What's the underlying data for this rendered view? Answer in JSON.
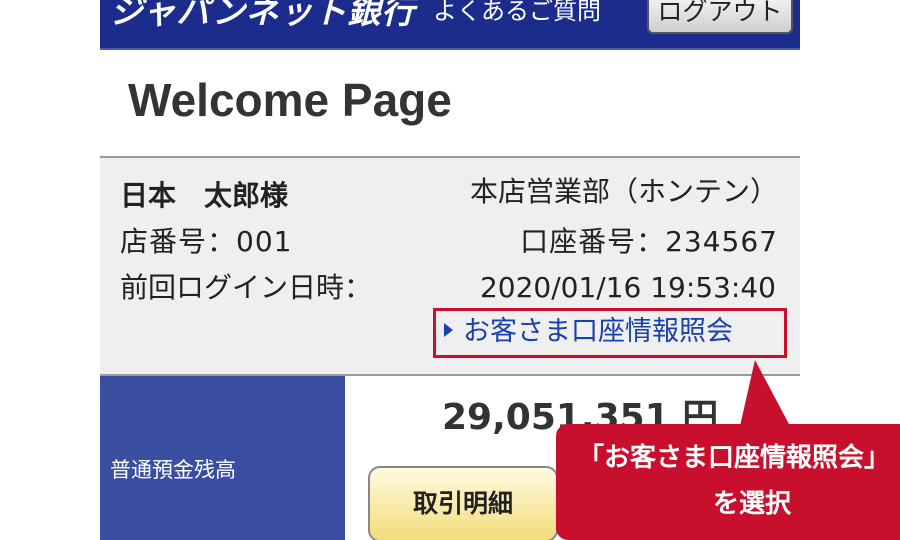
{
  "header": {
    "logo": "ジャパンネット銀行",
    "faq": "よくあるご質問",
    "logout": "ログアウト"
  },
  "page_title": "Welcome Page",
  "account_info": {
    "customer_name": "日本　太郎様",
    "branch_name": "本店営業部（ホンテン）",
    "store_number": "店番号：001",
    "account_number": "口座番号：234567",
    "last_login_label": "前回ログイン日時：",
    "last_login_value": "2020/01/16 19:53:40",
    "account_info_link": "お客さま口座情報照会"
  },
  "balance": {
    "label": "普通預金残高",
    "amount": "29,051,351 円",
    "detail_button": "取引明細"
  },
  "callout": {
    "line1": "「お客さま口座情報照会」",
    "line2": "を選択",
    "color": "#c8102e"
  }
}
